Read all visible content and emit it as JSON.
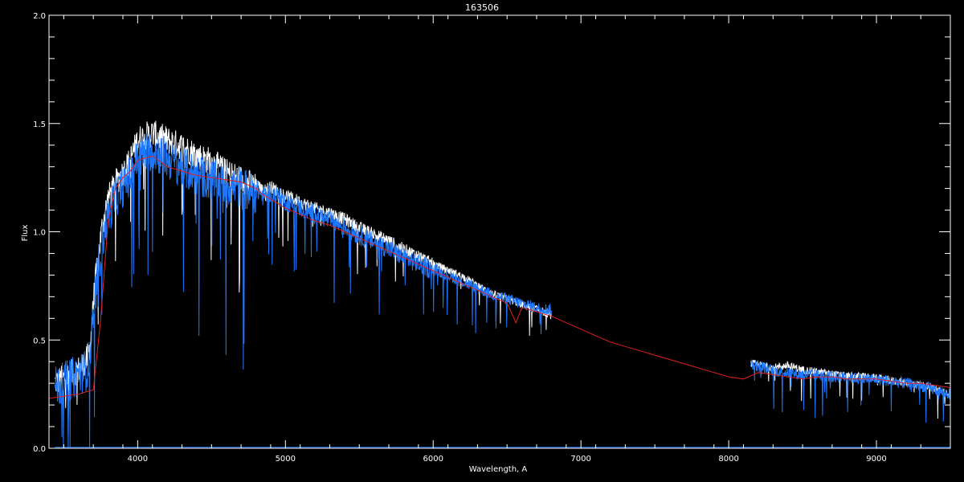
{
  "chart_data": {
    "type": "line",
    "title": "163506",
    "xlabel": "Wavelength, A",
    "ylabel": "Flux",
    "xlim": [
      3400,
      9500
    ],
    "ylim": [
      0.0,
      2.0
    ],
    "x_ticks": [
      {
        "value": 4000,
        "label": "4000"
      },
      {
        "value": 5000,
        "label": "5000"
      },
      {
        "value": 6000,
        "label": "6000"
      },
      {
        "value": 7000,
        "label": "7000"
      },
      {
        "value": 8000,
        "label": "8000"
      },
      {
        "value": 9000,
        "label": "9000"
      }
    ],
    "y_ticks": [
      {
        "value": 0.0,
        "label": "0.0"
      },
      {
        "value": 0.5,
        "label": "0.5"
      },
      {
        "value": 1.0,
        "label": "1.0"
      },
      {
        "value": 1.5,
        "label": "1.5"
      },
      {
        "value": 2.0,
        "label": "2.0"
      }
    ],
    "grid": false,
    "background": "#000000",
    "axis_color": "#ffffff",
    "series": [
      {
        "color": "#ffffff",
        "noise": 0.06,
        "segments": [
          {
            "x": [
              3440,
              3500,
              3550,
              3600,
              3650,
              3680,
              3700,
              3730,
              3760,
              3800,
              3850,
              3900,
              3950,
              4000,
              4050,
              4100,
              4200,
              4300,
              4400,
              4500,
              4600,
              4700,
              4800,
              4850,
              4900,
              5000,
              5100,
              5200,
              5300,
              5400,
              5500,
              5600,
              5700,
              5800,
              5900,
              6000,
              6100,
              6200,
              6300,
              6400,
              6500,
              6600,
              6700,
              6800
            ],
            "y": [
              0.33,
              0.35,
              0.37,
              0.39,
              0.42,
              0.5,
              0.7,
              0.9,
              1.05,
              1.18,
              1.25,
              1.3,
              1.36,
              1.45,
              1.47,
              1.48,
              1.45,
              1.42,
              1.38,
              1.35,
              1.3,
              1.27,
              1.23,
              1.2,
              1.22,
              1.18,
              1.15,
              1.12,
              1.1,
              1.07,
              1.03,
              1.0,
              0.97,
              0.93,
              0.9,
              0.86,
              0.83,
              0.8,
              0.76,
              0.72,
              0.7,
              0.67,
              0.65,
              0.62
            ]
          },
          {
            "x": [
              8150,
              8300,
              8400,
              8500,
              8600,
              8700,
              8800,
              8900,
              9000,
              9100,
              9200,
              9300,
              9400,
              9500
            ],
            "y": [
              0.4,
              0.38,
              0.39,
              0.37,
              0.36,
              0.35,
              0.34,
              0.34,
              0.33,
              0.32,
              0.31,
              0.3,
              0.28,
              0.26
            ]
          }
        ]
      },
      {
        "color": "#1e78ff",
        "noise": 0.09,
        "segments": [
          {
            "x": [
              3440,
              3500,
              3550,
              3600,
              3650,
              3680,
              3700,
              3730,
              3760,
              3800,
              3850,
              3900,
              3950,
              4000,
              4050,
              4100,
              4200,
              4300,
              4400,
              4500,
              4600,
              4700,
              4800,
              4850,
              4900,
              5000,
              5100,
              5200,
              5300,
              5400,
              5500,
              5600,
              5700,
              5800,
              5900,
              6000,
              6100,
              6200,
              6300,
              6400,
              6500,
              6600,
              6700,
              6800
            ],
            "y": [
              0.32,
              0.34,
              0.36,
              0.38,
              0.4,
              0.47,
              0.65,
              0.85,
              1.0,
              1.12,
              1.2,
              1.25,
              1.3,
              1.38,
              1.4,
              1.42,
              1.38,
              1.34,
              1.3,
              1.28,
              1.26,
              1.24,
              1.22,
              1.18,
              1.2,
              1.16,
              1.13,
              1.1,
              1.07,
              1.04,
              1.0,
              0.97,
              0.94,
              0.9,
              0.87,
              0.84,
              0.81,
              0.78,
              0.75,
              0.72,
              0.7,
              0.68,
              0.66,
              0.65
            ]
          },
          {
            "x": [
              8150,
              8300,
              8400,
              8500,
              8600,
              8700,
              8800,
              8900,
              9000,
              9100,
              9200,
              9300,
              9400,
              9500
            ],
            "y": [
              0.4,
              0.37,
              0.36,
              0.35,
              0.35,
              0.34,
              0.34,
              0.33,
              0.33,
              0.32,
              0.31,
              0.3,
              0.28,
              0.26
            ]
          },
          {
            "x": [
              3440,
              9500
            ],
            "y": [
              0.005,
              0.005
            ]
          }
        ]
      },
      {
        "color": "#e02020",
        "noise": 0.0,
        "segments": [
          {
            "x": [
              3400,
              3500,
              3600,
              3650,
              3700,
              3750,
              3800,
              3850,
              3900,
              3950,
              4000,
              4050,
              4100,
              4200,
              4300,
              4400,
              4500,
              4600,
              4700,
              4800,
              4850,
              4900,
              5000,
              5100,
              5200,
              5300,
              5400,
              5500,
              5600,
              5700,
              5800,
              5900,
              6000,
              6100,
              6200,
              6300,
              6400,
              6500,
              6560,
              6600,
              6700,
              6800,
              6900,
              7000,
              7100,
              7200,
              7300,
              7400,
              7500,
              7600,
              7700,
              7800,
              7900,
              8000,
              8100,
              8200,
              8300,
              8400,
              8500,
              8600,
              8700,
              8800,
              8900,
              9000,
              9100,
              9200,
              9300,
              9400,
              9500
            ],
            "y": [
              0.23,
              0.24,
              0.25,
              0.26,
              0.27,
              0.6,
              1.05,
              1.2,
              1.25,
              1.28,
              1.33,
              1.34,
              1.35,
              1.3,
              1.28,
              1.26,
              1.25,
              1.24,
              1.23,
              1.2,
              1.17,
              1.15,
              1.11,
              1.08,
              1.05,
              1.03,
              1.0,
              0.97,
              0.94,
              0.91,
              0.88,
              0.85,
              0.82,
              0.79,
              0.76,
              0.73,
              0.7,
              0.67,
              0.58,
              0.65,
              0.63,
              0.61,
              0.58,
              0.55,
              0.52,
              0.49,
              0.47,
              0.45,
              0.43,
              0.41,
              0.39,
              0.37,
              0.35,
              0.33,
              0.32,
              0.35,
              0.34,
              0.33,
              0.32,
              0.33,
              0.33,
              0.32,
              0.32,
              0.32,
              0.31,
              0.3,
              0.3,
              0.29,
              0.28
            ]
          }
        ]
      }
    ]
  }
}
